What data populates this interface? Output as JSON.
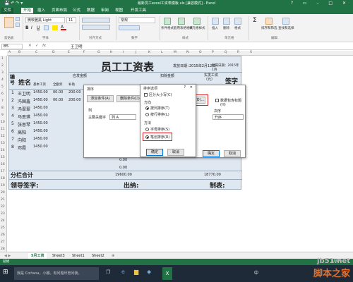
{
  "window": {
    "title": "最新员工excel工资表模板.xls [兼容模式] - Excel",
    "controls": "? ▭ – □ ✕"
  },
  "ribbon_tabs": [
    "文件",
    "开始",
    "插入",
    "页面布局",
    "公式",
    "数据",
    "审阅",
    "视图",
    "开发工具"
  ],
  "ribbon": {
    "font_name": "微软雅黑 Light",
    "font_size": "11",
    "number_format": "常规",
    "groups": [
      "剪贴板",
      "字体",
      "对齐方式",
      "数字",
      "样式",
      "单元格",
      "编辑"
    ],
    "buttons": [
      "条件格式",
      "套用表格格式",
      "单元格样式",
      "插入",
      "删除",
      "格式",
      "排序和筛选",
      "查找和选择"
    ]
  },
  "formula_bar": {
    "name_box": "B5",
    "fx": "fx",
    "value": "王卫明"
  },
  "columns": [
    "A",
    "B",
    "C",
    "D",
    "E",
    "F",
    "G",
    "H",
    "I",
    "J",
    "K",
    "L",
    "M",
    "N",
    "O",
    "P",
    "Q",
    "R",
    "S"
  ],
  "rows": [
    "1",
    "2",
    "3",
    "4",
    "5",
    "6",
    "7",
    "8",
    "9",
    "10",
    "11",
    "12",
    "13",
    "14",
    "15",
    "16",
    "17",
    "18",
    "19",
    "20",
    "21",
    "22",
    "23",
    "24",
    "25",
    "26",
    "27",
    "28"
  ],
  "payroll": {
    "title": "员工工资表",
    "issue_date_label": "发放日期：",
    "issue_date": "2015年2月12日",
    "period": "所属日期：2015年1月",
    "header_bianhao": "编号",
    "header_name": "姓名",
    "header_yingfa": "应发金额",
    "header_kouchu": "扣除金额",
    "header_jiben": "基本工资",
    "header_quanqin": "全勤奖",
    "header_butie": "补助",
    "header_shifa": "实发工资（元）",
    "header_qianzi": "签字",
    "employees": [
      {
        "no": "1",
        "name": "王卫明",
        "base": "1450.00",
        "a": "00.00",
        "b": "200.00"
      },
      {
        "no": "2",
        "name": "冯国鑫",
        "base": "1450.00",
        "a": "00.00",
        "b": "200.00"
      },
      {
        "no": "3",
        "name": "冯翠翠",
        "base": "1450.00",
        "a": "",
        "b": ""
      },
      {
        "no": "4",
        "name": "马思琪",
        "base": "1450.00",
        "a": "",
        "b": ""
      },
      {
        "no": "5",
        "name": "张思琴",
        "base": "1450.00",
        "a": "",
        "b": ""
      },
      {
        "no": "6",
        "name": "高阳",
        "base": "1450.00",
        "a": "",
        "b": ""
      },
      {
        "no": "7",
        "name": "向阳",
        "base": "1450.00",
        "a": "",
        "b": ""
      },
      {
        "no": "8",
        "name": "邓霞",
        "base": "1450.00",
        "a": "",
        "b": ""
      }
    ],
    "zero_values": [
      "0.00",
      "0.00"
    ],
    "subtotal_label": "分栏合计",
    "subtotal_value": "19600.00",
    "subtotal_value2": "18770.00",
    "footer_sign": "领导签字:",
    "footer_cashier": "出纳:",
    "footer_maker": "制表:"
  },
  "sort_dialog": {
    "title": "排序",
    "add_condition": "添加条件(A)",
    "delete_condition": "删除条件(D)",
    "column_header": "列",
    "key_label": "主要关键字",
    "key_value": "列 A",
    "order_header": "次序",
    "order_value": "升序",
    "data_has_headers": "数据包含标题(H)",
    "options_button": "选项(O)...",
    "ok": "确定",
    "cancel": "取消"
  },
  "options_dialog": {
    "title": "排序选项",
    "help": "?",
    "close": "✕",
    "case_sensitive": "区分大小写(C)",
    "direction_label": "方向",
    "by_column": "按列排序(T)",
    "by_row": "按行排序(L)",
    "method_label": "方法",
    "by_letter": "字母排序(S)",
    "by_stroke": "笔划排序(R)",
    "ok": "确定",
    "cancel": "取消"
  },
  "sheet_tabs": [
    "5月工资",
    "Sheet3",
    "Sheet1",
    "Sheet2"
  ],
  "status": {
    "left": "就绪",
    "zoom": "100%"
  },
  "taskbar": {
    "search_placeholder": "我是 Cortana，小娜。有问题尽管问我。",
    "lang": "中"
  },
  "watermark": {
    "domain": "jb51.net",
    "brand": "脚本之家"
  },
  "colors": {
    "excel_green": "#217346",
    "highlight_red": "#e02020"
  }
}
